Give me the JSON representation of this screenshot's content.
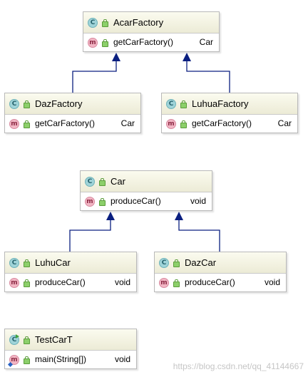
{
  "classes": [
    {
      "id": "acar",
      "name": "AcarFactory",
      "member": "getCarFactory()",
      "type": "Car"
    },
    {
      "id": "daz",
      "name": "DazFactory",
      "member": "getCarFactory()",
      "type": "Car"
    },
    {
      "id": "luhua",
      "name": "LuhuaFactory",
      "member": "getCarFactory()",
      "type": "Car"
    },
    {
      "id": "car",
      "name": "Car",
      "member": "produceCar()",
      "type": "void"
    },
    {
      "id": "luhucar",
      "name": "LuhuCar",
      "member": "produceCar()",
      "type": "void"
    },
    {
      "id": "dazcar",
      "name": "DazCar",
      "member": "produceCar()",
      "type": "void"
    },
    {
      "id": "test",
      "name": "TestCarT",
      "member": "main(String[])",
      "type": "void"
    }
  ],
  "badges": {
    "class": "C",
    "method": "m"
  },
  "colors": {
    "arrow": "#0a1f80",
    "header": "#ecebd6"
  },
  "watermark": "https://blog.csdn.net/qq_41144667"
}
